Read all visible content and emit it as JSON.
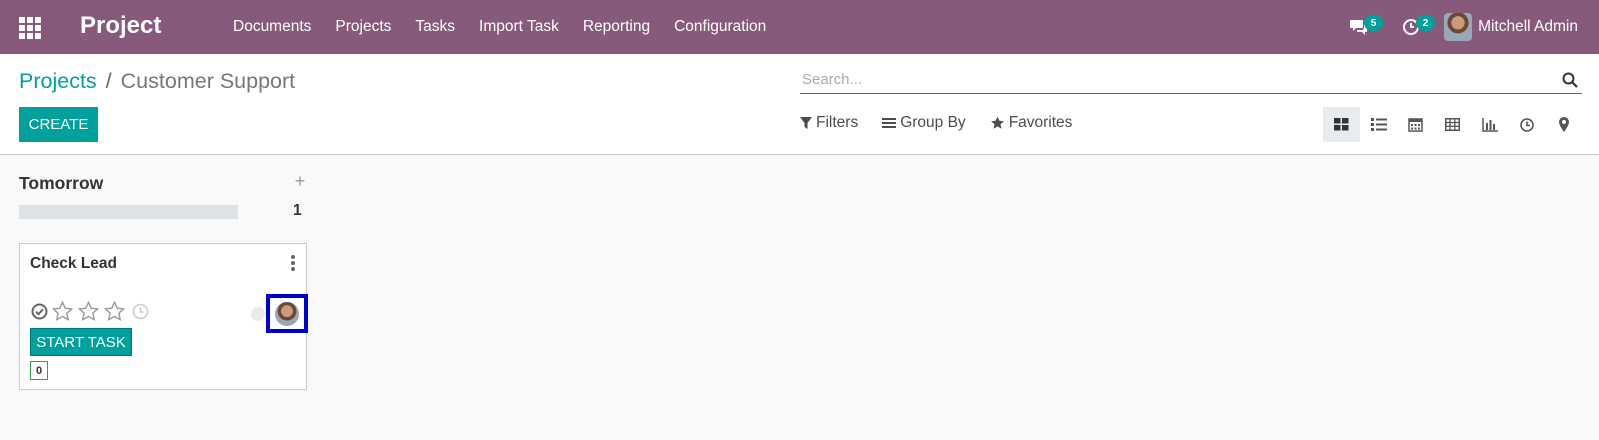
{
  "navbar": {
    "apps_icon": "apps-grid-icon",
    "brand": "Project",
    "menu": [
      "Documents",
      "Projects",
      "Tasks",
      "Import Task",
      "Reporting",
      "Configuration"
    ],
    "messages_count": "5",
    "activities_count": "2",
    "user_name": "Mitchell Admin",
    "bg_color": "#875a7b"
  },
  "breadcrumb": {
    "parent": "Projects",
    "separator": "/",
    "current": "Customer Support"
  },
  "toolbar": {
    "create_label": "CREATE",
    "search_placeholder": "Search...",
    "filters_label": "Filters",
    "group_by_label": "Group By",
    "favorites_label": "Favorites"
  },
  "views": [
    "kanban-view-icon",
    "list-view-icon",
    "calendar-view-icon",
    "pivot-view-icon",
    "graph-view-icon",
    "activity-view-icon",
    "map-view-icon"
  ],
  "kanban": {
    "column": {
      "title": "Tomorrow",
      "count": "1",
      "progress": 0
    },
    "card": {
      "title": "Check Lead",
      "priority_stars": 3,
      "start_label": "START TASK",
      "counter": "0"
    }
  },
  "colors": {
    "accent": "#00a09d",
    "highlight_frame": "#0000cc"
  }
}
